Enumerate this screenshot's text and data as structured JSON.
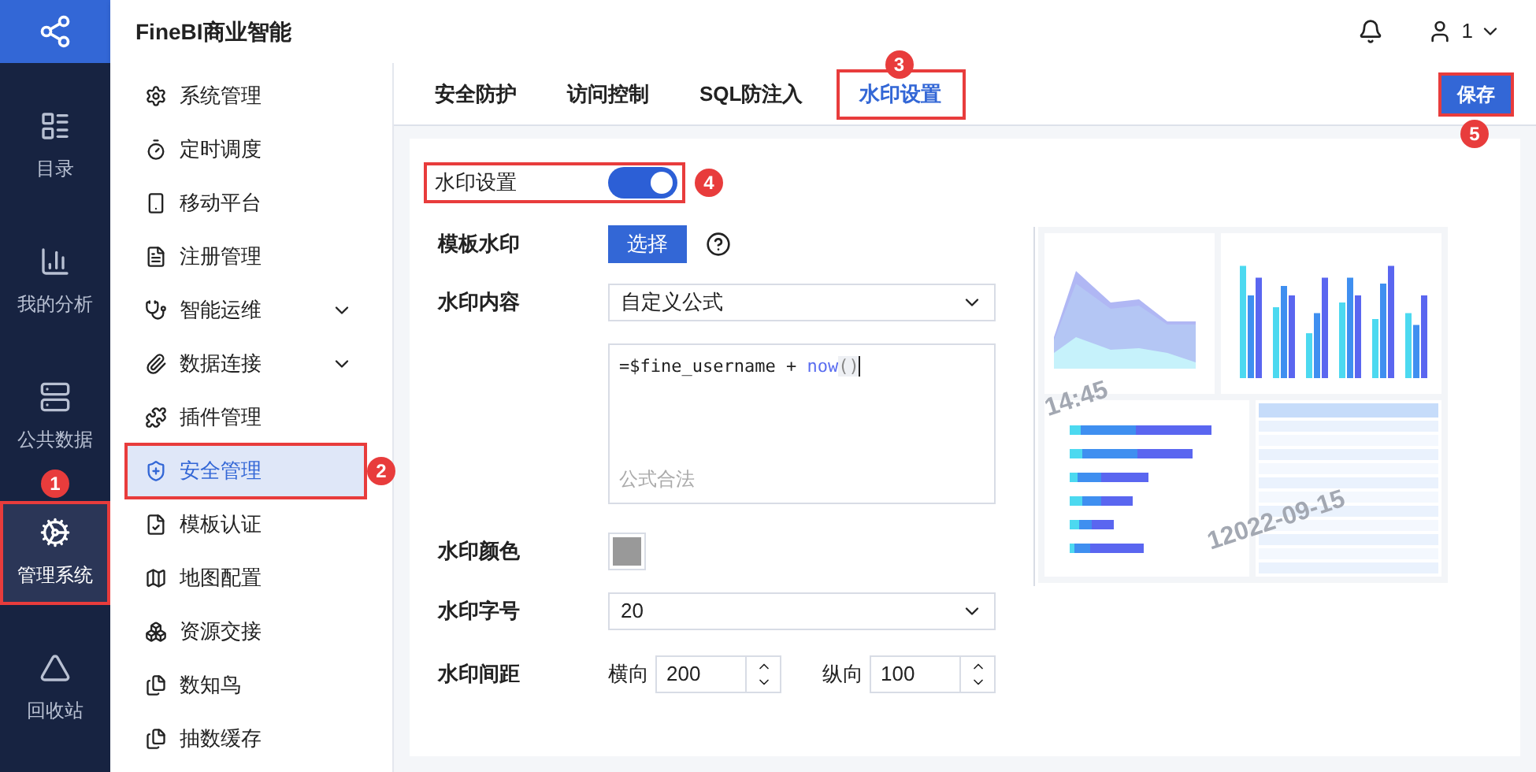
{
  "app": {
    "title": "FineBI商业智能",
    "user": "1"
  },
  "nav": [
    {
      "label": "目录",
      "kind": "catalog",
      "selected": false
    },
    {
      "label": "我的分析",
      "kind": "analysis",
      "selected": false
    },
    {
      "label": "公共数据",
      "kind": "data",
      "selected": false
    },
    {
      "label": "管理系统",
      "kind": "admin",
      "selected": true,
      "badge": "1"
    },
    {
      "label": "回收站",
      "kind": "trash",
      "selected": false
    }
  ],
  "menu": [
    {
      "label": "系统管理",
      "kind": "gear",
      "selected": false,
      "expandable": false
    },
    {
      "label": "定时调度",
      "kind": "timer",
      "selected": false,
      "expandable": false
    },
    {
      "label": "移动平台",
      "kind": "phone",
      "selected": false,
      "expandable": false
    },
    {
      "label": "注册管理",
      "kind": "register",
      "selected": false,
      "expandable": false
    },
    {
      "label": "智能运维",
      "kind": "ops",
      "selected": false,
      "expandable": true
    },
    {
      "label": "数据连接",
      "kind": "clip",
      "selected": false,
      "expandable": true
    },
    {
      "label": "插件管理",
      "kind": "puzzle",
      "selected": false,
      "expandable": false
    },
    {
      "label": "安全管理",
      "kind": "shield",
      "selected": true,
      "expandable": false,
      "badge": "2"
    },
    {
      "label": "模板认证",
      "kind": "cert",
      "selected": false,
      "expandable": false
    },
    {
      "label": "地图配置",
      "kind": "map",
      "selected": false,
      "expandable": false
    },
    {
      "label": "资源交接",
      "kind": "resource",
      "selected": false,
      "expandable": false
    },
    {
      "label": "数知鸟",
      "kind": "file",
      "selected": false,
      "expandable": false
    },
    {
      "label": "抽数缓存",
      "kind": "file",
      "selected": false,
      "expandable": false
    }
  ],
  "tabs": [
    {
      "label": "安全防护",
      "selected": false
    },
    {
      "label": "访问控制",
      "selected": false
    },
    {
      "label": "SQL防注入",
      "selected": false
    },
    {
      "label": "水印设置",
      "selected": true,
      "badge": "3"
    }
  ],
  "save_button": {
    "label": "保存",
    "badge": "5"
  },
  "settings": {
    "toggle": {
      "label": "水印设置",
      "on": true,
      "badge": "4"
    },
    "template": {
      "label": "模板水印",
      "button": "选择"
    },
    "content": {
      "label": "水印内容",
      "value": "自定义公式"
    },
    "formula": {
      "text": "=$fine_username + ",
      "func": "now",
      "parens": "()",
      "status": "公式合法"
    },
    "color": {
      "label": "水印颜色",
      "color": "#999999"
    },
    "size": {
      "label": "水印字号",
      "value": "20"
    },
    "spacing": {
      "label": "水印间距",
      "h_label": "横向",
      "h_value": "200",
      "v_label": "纵向",
      "v_value": "100"
    }
  },
  "preview": {
    "watermarks": [
      "14:45",
      "12022-09-15"
    ]
  }
}
